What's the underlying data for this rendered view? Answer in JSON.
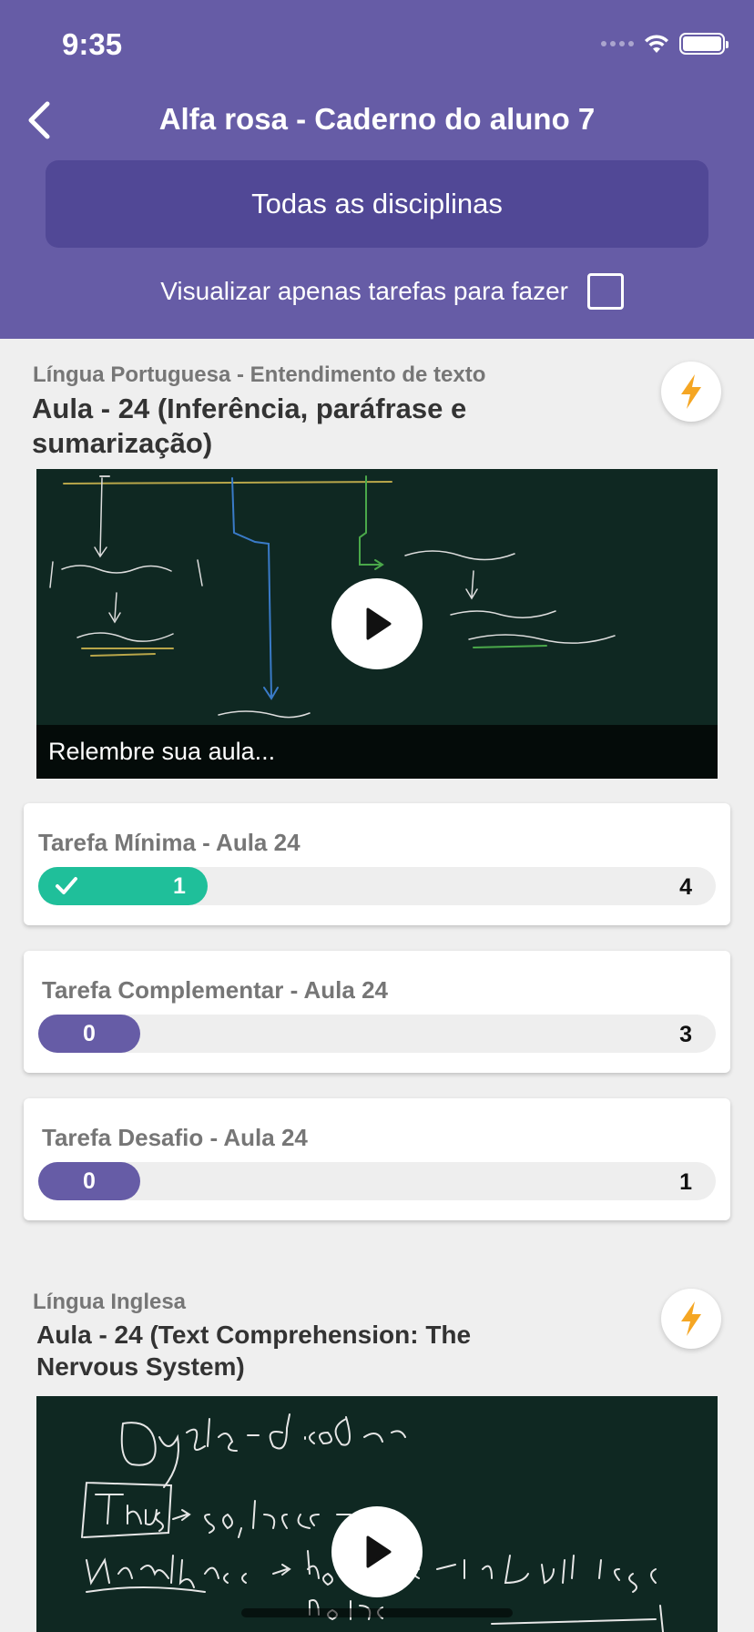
{
  "status_bar": {
    "time": "9:35"
  },
  "header": {
    "title": "Alfa rosa - Caderno do aluno 7",
    "discipline_button": "Todas as disciplinas",
    "filter_label": "Visualizar apenas tarefas para fazer",
    "filter_checked": false
  },
  "lessons": [
    {
      "subject": "Língua Portuguesa - Entendimento de texto",
      "title": "Aula - 24 (Inferência, paráfrase e sumarização)",
      "video_caption": "Relembre sua aula...",
      "tasks": [
        {
          "title": "Tarefa Mínima - Aula 24",
          "done": "1",
          "total": "4",
          "completed": true,
          "progress": 0.25
        },
        {
          "title": "Tarefa Complementar - Aula 24",
          "done": "0",
          "total": "3",
          "completed": false,
          "progress": 0.0
        },
        {
          "title": "Tarefa Desafio - Aula 24",
          "done": "0",
          "total": "1",
          "completed": false,
          "progress": 0.0
        }
      ]
    },
    {
      "subject": "Língua Inglesa",
      "title": "Aula - 24 (Text Comprehension: The Nervous System)"
    }
  ],
  "colors": {
    "header": "#665ca6",
    "button": "#514896",
    "complete": "#1fbf9a",
    "pending": "#665ca6",
    "bolt": "#f5a623"
  },
  "icons": [
    "back-chevron-icon",
    "wifi-icon",
    "battery-icon",
    "lightning-icon",
    "play-icon",
    "check-icon"
  ]
}
